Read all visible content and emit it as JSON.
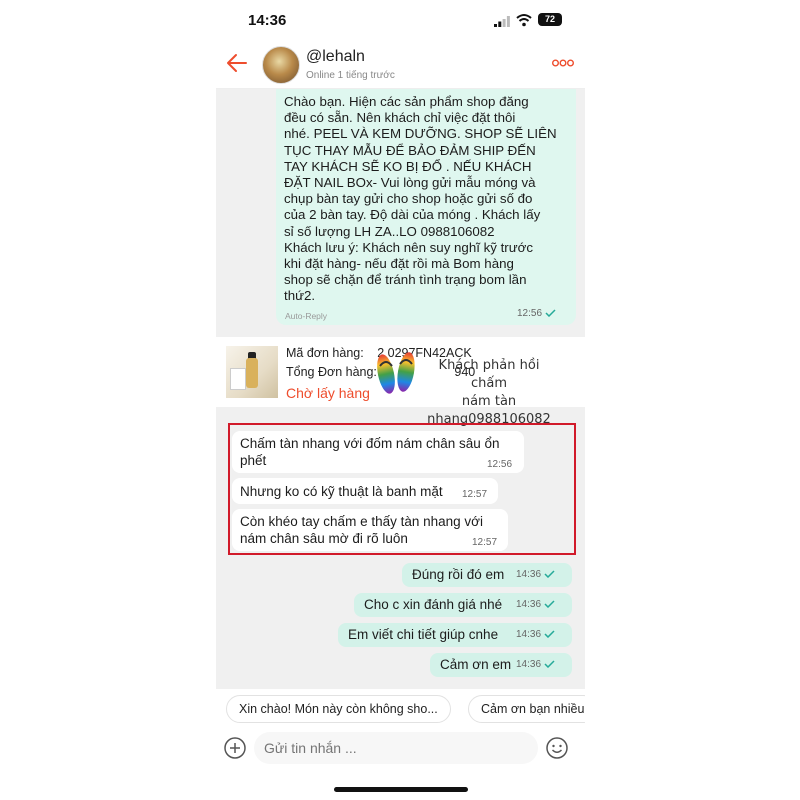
{
  "status_bar": {
    "time": "14:36",
    "battery": "72"
  },
  "header": {
    "username": "@lehaln",
    "online_status": "Online 1 tiếng trước"
  },
  "auto_reply": {
    "lines": [
      "Chào bạn. Hiện các sản phẩm shop đăng",
      "đều có sẵn. Nên khách chỉ việc đặt thôi",
      "nhé. PEEL VÀ KEM DƯỠNG. SHOP SẼ LIÊN",
      "TỤC THAY MẪU ĐỂ BẢO ĐẢM SHIP ĐẾN",
      "TAY KHÁCH SẼ KO BỊ ĐỔ . NẾU KHÁCH",
      "ĐẶT NAIL BOx- Vui lòng gửi mẫu móng và",
      "chụp bàn tay gửi cho shop hoặc gửi số đo",
      "của 2 bàn tay. Độ dài của móng . Khách lấy",
      "sỉ số lượng LH ZA..LO 0988106082",
      "Khách lưu ý: Khách nên suy nghĩ kỹ trước",
      "khi đặt hàng- nếu đặt rồi mà Bom hàng",
      "shop sẽ chặn để tránh tình trạng bom lần",
      "thứ2."
    ],
    "label": "Auto-Reply",
    "time": "12:56"
  },
  "order": {
    "code_label": "Mã đơn hàng:",
    "code_value": "2 0297FN42ACK",
    "total_label": "Tổng Đơn hàng:",
    "total_value": "940",
    "status": "Chờ lấy hàng"
  },
  "overlay_note": [
    "Khách phản hồi chấm",
    "nám tàn",
    "nhang0988106082"
  ],
  "incoming": [
    {
      "line1": "Chấm tàn nhang với đốm nám chân sâu ổn",
      "line2": "phết",
      "time": "12:56"
    },
    {
      "line1": "Nhưng ko có kỹ thuật là banh mặt",
      "line2": "",
      "time": "12:57"
    },
    {
      "line1": "Còn khéo tay chấm e thấy tàn nhang với",
      "line2": "nám chân sâu mờ đi rõ luôn",
      "time": "12:57"
    }
  ],
  "outgoing": [
    {
      "text": "Đúng rồi đó em",
      "time": "14:36"
    },
    {
      "text": "Cho c xin đánh giá nhé",
      "time": "14:36"
    },
    {
      "text": "Em viết chi tiết giúp cnhe",
      "time": "14:36"
    },
    {
      "text": "Cảm ơn em",
      "time": "14:36"
    }
  ],
  "quick_replies": [
    "Xin chào! Món này còn không sho...",
    "Cảm ơn bạn nhiều"
  ],
  "composer": {
    "placeholder": "Gửi tin nhắn ..."
  },
  "icons": {
    "back": "back-arrow-icon",
    "more": "more-dots-icon",
    "plus": "plus-circle-icon",
    "emoji": "emoji-icon"
  },
  "colors": {
    "accent": "#ee4d2d",
    "outgoing_bubble": "#d3f2e9",
    "auto_reply_bubble": "#dff7ef",
    "highlight_box": "#d11a2a"
  }
}
